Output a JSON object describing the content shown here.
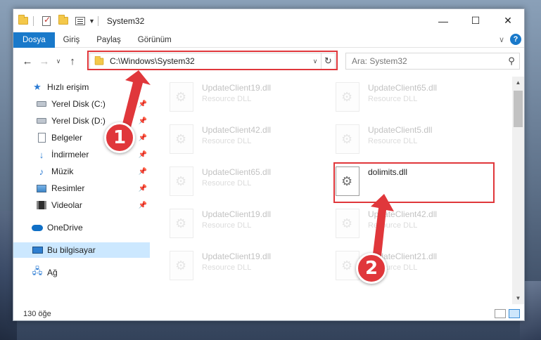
{
  "window": {
    "title": "System32",
    "controls": {
      "minimize": "—",
      "maximize": "☐",
      "close": "✕"
    }
  },
  "ribbon": {
    "tabs": [
      "Dosya",
      "Giriş",
      "Paylaş",
      "Görünüm"
    ],
    "active_tab": "Dosya",
    "help_label": "?"
  },
  "address_bar": {
    "path": "C:\\Windows\\System32",
    "search_placeholder": "Ara: System32"
  },
  "nav_pane": {
    "items": [
      {
        "label": "Hızlı erişim",
        "icon": "star-icon",
        "pinned": false
      },
      {
        "label": "Yerel Disk (C:)",
        "icon": "drive-icon",
        "pinned": true
      },
      {
        "label": "Yerel Disk (D:)",
        "icon": "drive-icon",
        "pinned": true
      },
      {
        "label": "Belgeler",
        "icon": "document-icon",
        "pinned": true
      },
      {
        "label": "İndirmeler",
        "icon": "download-icon",
        "pinned": true
      },
      {
        "label": "Müzik",
        "icon": "music-icon",
        "pinned": true
      },
      {
        "label": "Resimler",
        "icon": "pictures-icon",
        "pinned": true
      },
      {
        "label": "Videolar",
        "icon": "videos-icon",
        "pinned": true
      },
      {
        "label": "OneDrive",
        "icon": "cloud-icon",
        "pinned": false
      },
      {
        "label": "Bu bilgisayar",
        "icon": "computer-icon",
        "pinned": false,
        "selected": true
      },
      {
        "label": "Ağ",
        "icon": "network-icon",
        "pinned": false
      }
    ]
  },
  "files": [
    {
      "name": "UpdateClient19.dll",
      "type": "Resource DLL"
    },
    {
      "name": "UpdateClient65.dll",
      "type": "Resource DLL"
    },
    {
      "name": "UpdateClient42.dll",
      "type": "Resource DLL"
    },
    {
      "name": "UpdateClient5.dll",
      "type": "Resource DLL"
    },
    {
      "name": "UpdateClient65.dll",
      "type": "Resource DLL"
    },
    {
      "name": "dolimits.dll",
      "type": "",
      "highlighted": true
    },
    {
      "name": "UpdateClient19.dll",
      "type": "Resource DLL"
    },
    {
      "name": "UpdateClient42.dll",
      "type": "Resource DLL"
    },
    {
      "name": "UpdateClient19.dll",
      "type": "Resource DLL"
    },
    {
      "name": "UpdateClient21.dll",
      "type": "Resource DLL"
    }
  ],
  "status": {
    "item_count": "130 öğe"
  },
  "annotations": {
    "step1": "1",
    "step2": "2",
    "color": "#e0373b"
  }
}
